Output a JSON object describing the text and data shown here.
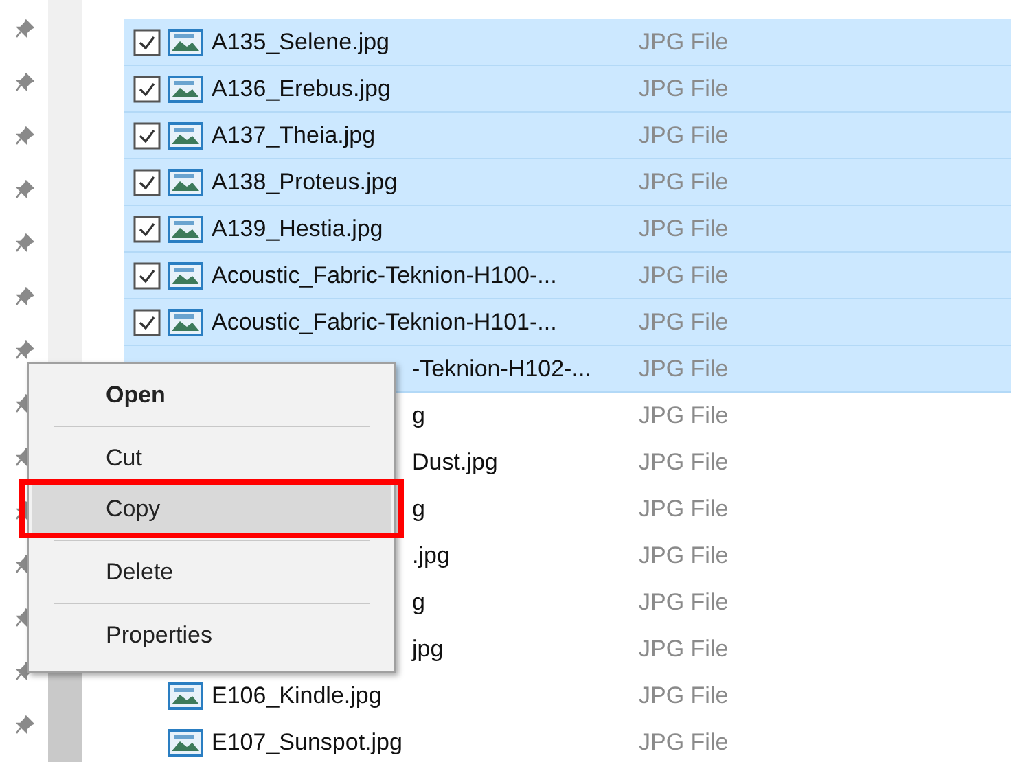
{
  "files": [
    {
      "name": "A135_Selene.jpg",
      "type": "JPG File",
      "selected": true,
      "checked": true,
      "covered": false
    },
    {
      "name": "A136_Erebus.jpg",
      "type": "JPG File",
      "selected": true,
      "checked": true,
      "covered": false
    },
    {
      "name": "A137_Theia.jpg",
      "type": "JPG File",
      "selected": true,
      "checked": true,
      "covered": false
    },
    {
      "name": "A138_Proteus.jpg",
      "type": "JPG File",
      "selected": true,
      "checked": true,
      "covered": false
    },
    {
      "name": "A139_Hestia.jpg",
      "type": "JPG File",
      "selected": true,
      "checked": true,
      "covered": false
    },
    {
      "name": "Acoustic_Fabric-Teknion-H100-...",
      "type": "JPG File",
      "selected": true,
      "checked": true,
      "covered": false
    },
    {
      "name": "Acoustic_Fabric-Teknion-H101-...",
      "type": "JPG File",
      "selected": true,
      "checked": true,
      "covered": false
    },
    {
      "name": "-Teknion-H102-...",
      "type": "JPG File",
      "selected": true,
      "covered": true
    },
    {
      "name": "g",
      "type": "JPG File",
      "selected": false,
      "covered": true
    },
    {
      "name": "Dust.jpg",
      "type": "JPG File",
      "selected": false,
      "covered": true
    },
    {
      "name": "g",
      "type": "JPG File",
      "selected": false,
      "covered": true
    },
    {
      "name": ".jpg",
      "type": "JPG File",
      "selected": false,
      "covered": true
    },
    {
      "name": "g",
      "type": "JPG File",
      "selected": false,
      "covered": true
    },
    {
      "name": "jpg",
      "type": "JPG File",
      "selected": false,
      "covered": true
    },
    {
      "name": "E106_Kindle.jpg",
      "type": "JPG File",
      "selected": false,
      "checked": false,
      "covered": false
    },
    {
      "name": "E107_Sunspot.jpg",
      "type": "JPG File",
      "selected": false,
      "checked": false,
      "covered": false
    }
  ],
  "context_menu": {
    "items": [
      {
        "kind": "command",
        "label": "Open",
        "default": true,
        "selected": false,
        "outlined": false
      },
      {
        "kind": "separator"
      },
      {
        "kind": "command",
        "label": "Cut",
        "default": false,
        "selected": false,
        "outlined": false
      },
      {
        "kind": "command",
        "label": "Copy",
        "default": false,
        "selected": true,
        "outlined": true
      },
      {
        "kind": "separator"
      },
      {
        "kind": "command",
        "label": "Delete",
        "default": false,
        "selected": false,
        "outlined": false
      },
      {
        "kind": "separator"
      },
      {
        "kind": "command",
        "label": "Properties",
        "default": false,
        "selected": false,
        "outlined": false
      }
    ]
  }
}
